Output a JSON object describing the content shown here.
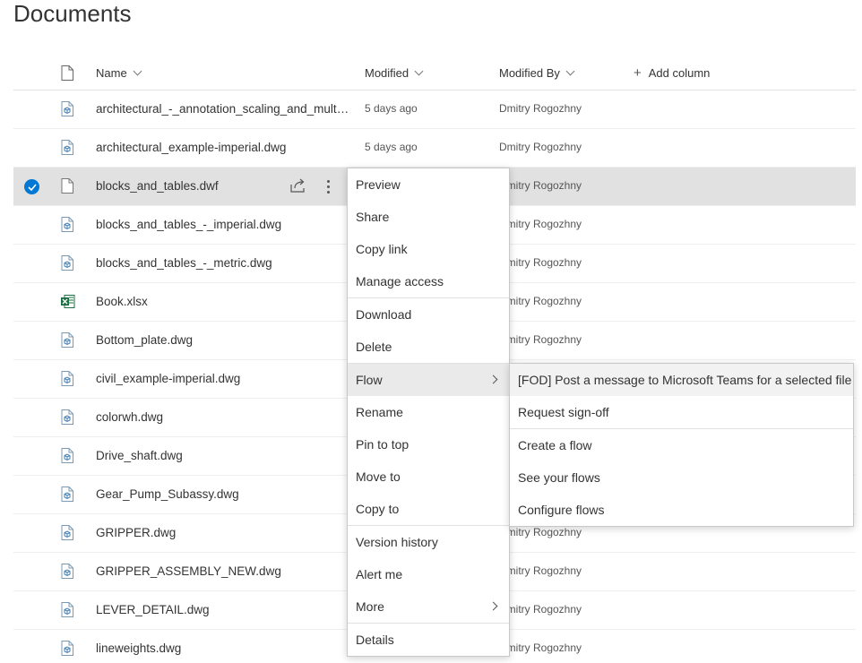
{
  "page": {
    "title": "Documents"
  },
  "columns": {
    "name": "Name",
    "modified": "Modified",
    "modified_by": "Modified By",
    "add_column": "Add column"
  },
  "colors": {
    "accent": "#0078d4",
    "excel": "#1d6f42",
    "selected_row": "#e1e1e1"
  },
  "files": [
    {
      "name": "architectural_-_annotation_scaling_and_multileaders.dwg",
      "modified": "5 days ago",
      "modified_by": "Dmitry Rogozhny",
      "icon": "cad-file-icon"
    },
    {
      "name": "architectural_example-imperial.dwg",
      "modified": "5 days ago",
      "modified_by": "Dmitry Rogozhny",
      "icon": "cad-file-icon"
    },
    {
      "name": "blocks_and_tables.dwf",
      "modified": "",
      "modified_by": "Dmitry Rogozhny",
      "icon": "generic-file-icon",
      "selected": true
    },
    {
      "name": "blocks_and_tables_-_imperial.dwg",
      "modified": "",
      "modified_by": "Dmitry Rogozhny",
      "icon": "cad-file-icon"
    },
    {
      "name": "blocks_and_tables_-_metric.dwg",
      "modified": "",
      "modified_by": "Dmitry Rogozhny",
      "icon": "cad-file-icon"
    },
    {
      "name": "Book.xlsx",
      "modified": "",
      "modified_by": "Dmitry Rogozhny",
      "icon": "excel-file-icon"
    },
    {
      "name": "Bottom_plate.dwg",
      "modified": "",
      "modified_by": "Dmitry Rogozhny",
      "icon": "cad-file-icon"
    },
    {
      "name": "civil_example-imperial.dwg",
      "modified": "",
      "modified_by": "",
      "icon": "cad-file-icon"
    },
    {
      "name": "colorwh.dwg",
      "modified": "",
      "modified_by": "",
      "icon": "cad-file-icon"
    },
    {
      "name": "Drive_shaft.dwg",
      "modified": "",
      "modified_by": "",
      "icon": "cad-file-icon"
    },
    {
      "name": "Gear_Pump_Subassy.dwg",
      "modified": "",
      "modified_by": "",
      "icon": "cad-file-icon"
    },
    {
      "name": "GRIPPER.dwg",
      "modified": "",
      "modified_by": "Dmitry Rogozhny",
      "icon": "cad-file-icon"
    },
    {
      "name": "GRIPPER_ASSEMBLY_NEW.dwg",
      "modified": "",
      "modified_by": "Dmitry Rogozhny",
      "icon": "cad-file-icon"
    },
    {
      "name": "LEVER_DETAIL.dwg",
      "modified": "",
      "modified_by": "Dmitry Rogozhny",
      "icon": "cad-file-icon"
    },
    {
      "name": "lineweights.dwg",
      "modified": "",
      "modified_by": "Dmitry Rogozhny",
      "icon": "cad-file-icon"
    }
  ],
  "context_menu": {
    "items": [
      "Preview",
      "Share",
      "Copy link",
      "Manage access",
      "Download",
      "Delete",
      "Flow",
      "Rename",
      "Pin to top",
      "Move to",
      "Copy to",
      "Version history",
      "Alert me",
      "More",
      "Details"
    ]
  },
  "flow_submenu": {
    "items": [
      "[FOD] Post a message to Microsoft Teams for a selected file",
      "Request sign-off",
      "Create a flow",
      "See your flows",
      "Configure flows"
    ]
  }
}
